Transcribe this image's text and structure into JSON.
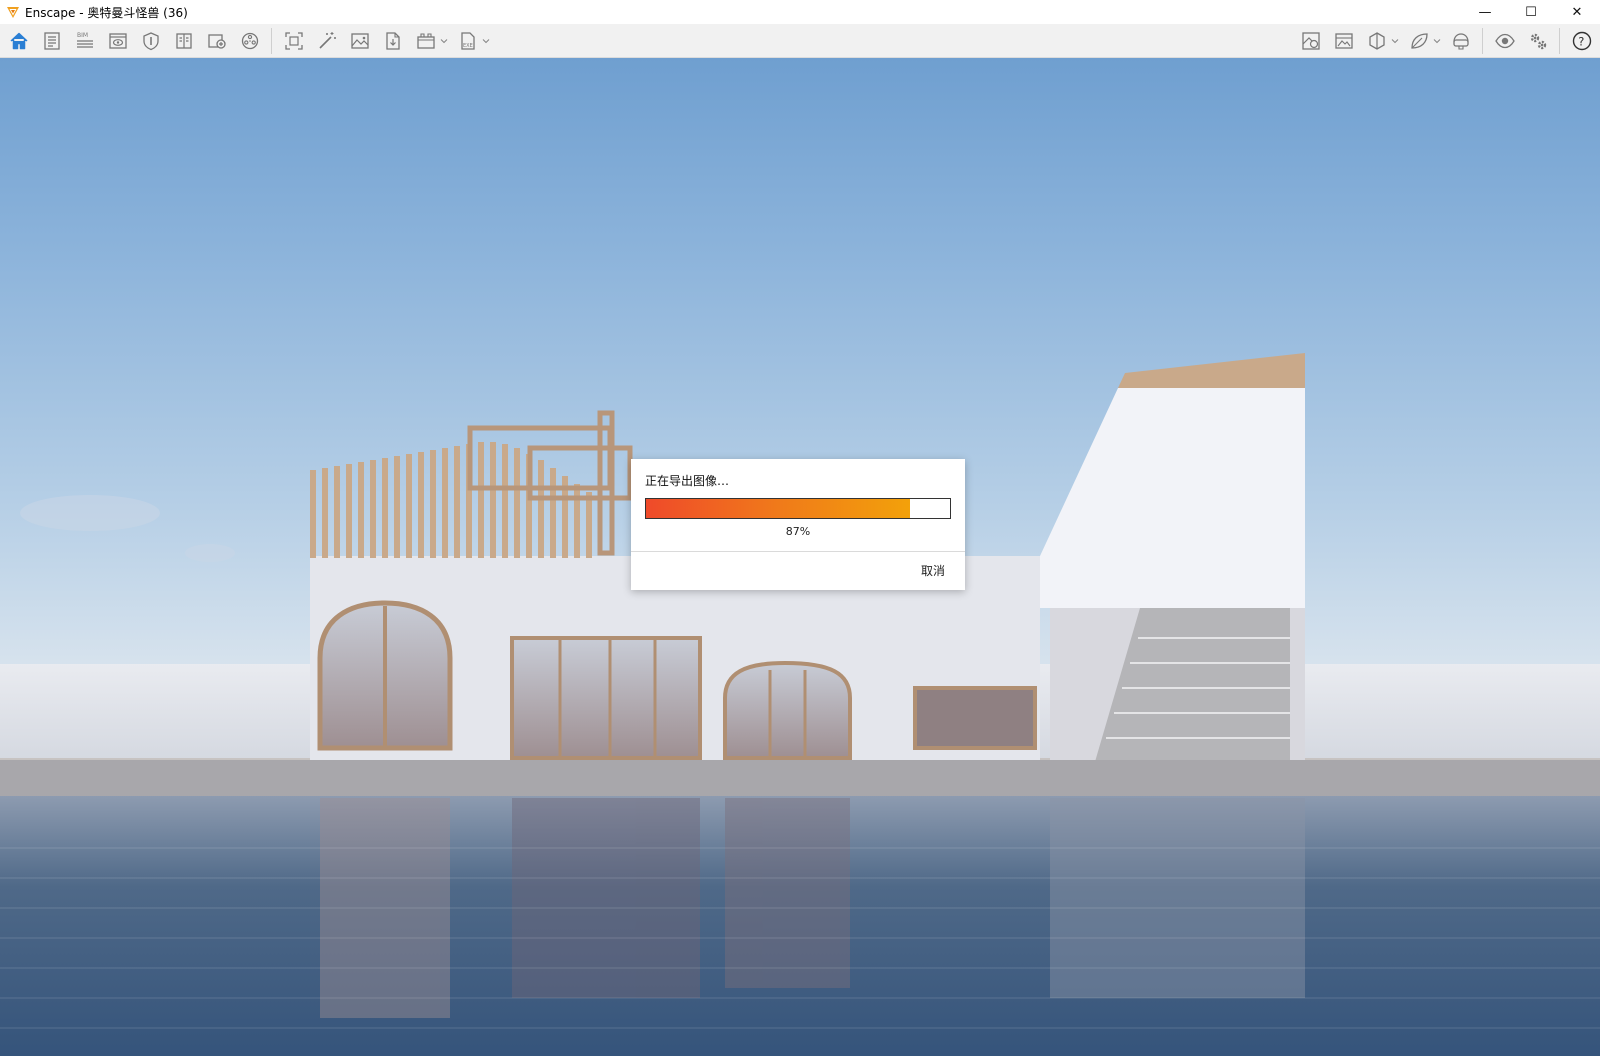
{
  "window": {
    "title": "Enscape - 奥特曼斗怪兽 (36)",
    "controls": {
      "minimize": "—",
      "maximize": "☐",
      "close": "✕"
    }
  },
  "toolbar": {
    "left": [
      {
        "icon": "home-icon"
      },
      {
        "icon": "document-icon"
      },
      {
        "icon": "bim-icon",
        "label": "BIM"
      },
      {
        "icon": "view-icon"
      },
      {
        "icon": "shield-icon"
      },
      {
        "icon": "book-icon"
      },
      {
        "icon": "add-view-icon"
      },
      {
        "icon": "video-editor-icon"
      },
      {
        "icon": "screenshot-icon"
      },
      {
        "icon": "magic-wand-icon"
      },
      {
        "icon": "image-icon"
      },
      {
        "icon": "export-file-icon"
      },
      {
        "icon": "batch-render-icon"
      },
      {
        "icon": "exe-export-icon",
        "label": "EXE"
      }
    ],
    "right": [
      {
        "icon": "material-editor-icon"
      },
      {
        "icon": "asset-library-icon"
      },
      {
        "icon": "section-view-icon"
      },
      {
        "icon": "leaf-icon"
      },
      {
        "icon": "vr-headset-icon"
      },
      {
        "icon": "visual-settings-icon"
      },
      {
        "icon": "settings-icon"
      },
      {
        "icon": "help-icon",
        "label": "?"
      }
    ]
  },
  "export_dialog": {
    "title": "正在导出图像…",
    "progress_percent": 87,
    "progress_label": "87%",
    "cancel_label": "取消"
  },
  "colors": {
    "accent_home": "#2a7fd4",
    "progress_start": "#ef4a2a",
    "progress_end": "#f3a10a"
  }
}
